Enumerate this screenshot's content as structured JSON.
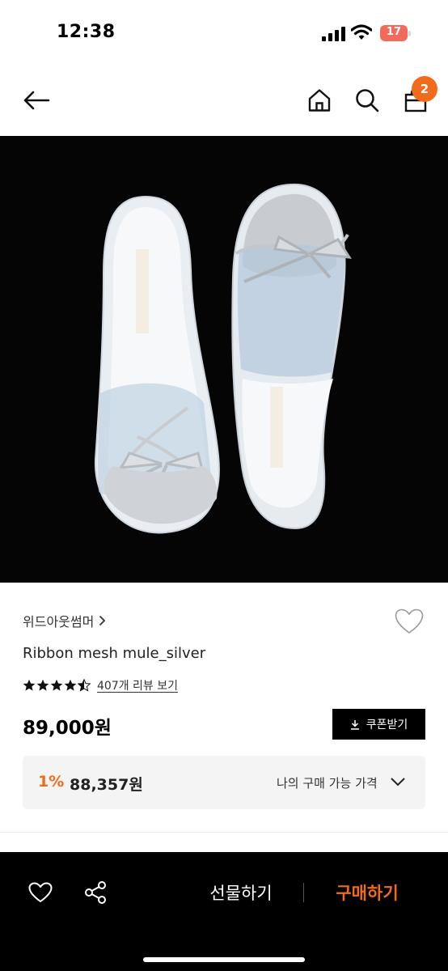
{
  "status_bar": {
    "time": "12:38",
    "battery": "17"
  },
  "nav": {
    "cart_count": "2"
  },
  "product": {
    "brand": "위드아웃썸머",
    "name": "Ribbon mesh mule_silver",
    "rating": 4.5,
    "review_link": "407개 리뷰 보기",
    "price": "89,000원",
    "coupon_label": "쿠폰받기",
    "discount": "1%",
    "my_price": "88,357원",
    "my_price_label": "나의 구매 가능 가격"
  },
  "bottom_bar": {
    "gift_label": "선물하기",
    "buy_label": "구매하기"
  },
  "colors": {
    "accent": "#f26a1b",
    "battery": "#f36a5d"
  },
  "icons": [
    "back-arrow-icon",
    "home-icon",
    "search-icon",
    "shopping-bag-icon",
    "heart-icon",
    "star-icon",
    "download-icon",
    "chevron-down-icon",
    "share-icon"
  ]
}
